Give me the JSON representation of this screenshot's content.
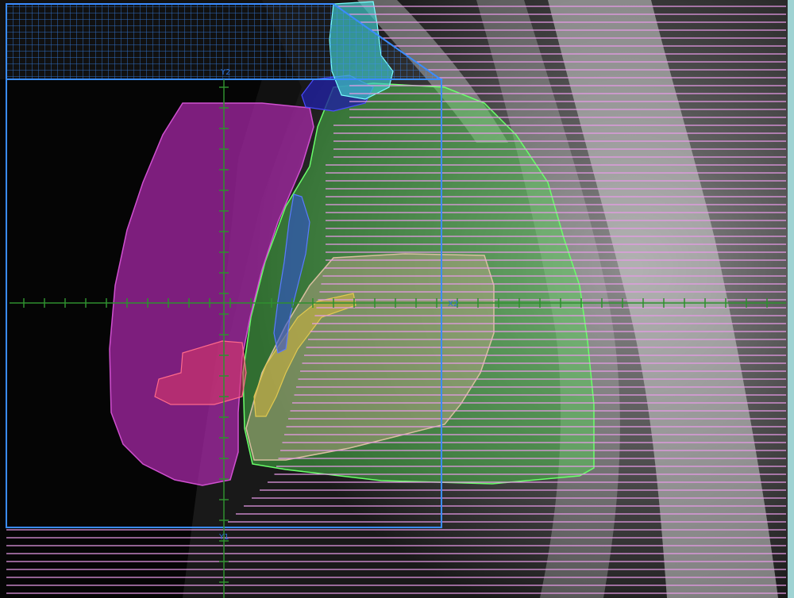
{
  "view": {
    "axis_tags": {
      "top": "Y2",
      "bottom": "Y1",
      "right": "X2"
    }
  },
  "colors": {
    "background_dark": "#0a0a0a",
    "mlc_leaf_line": "#e89ae8",
    "jaw_outline": "#3a8cff",
    "crosshair": "#2f8f2f",
    "heart": "#b02ab0",
    "lung": "#4fd84f",
    "ptv": "#b0a08a",
    "structure_yellow": "#c9b040",
    "structure_blue": "#3050d0",
    "structure_cyan": "#40c8c8",
    "structure_red": "#e03a6a",
    "right_edge_strip": "#9fd3d3"
  }
}
